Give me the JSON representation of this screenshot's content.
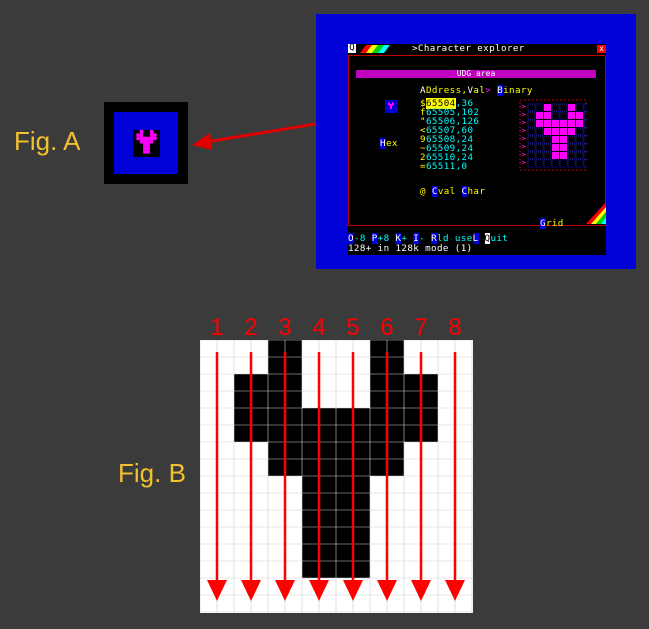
{
  "figures": {
    "a_label": "Fig. A",
    "b_label": "Fig. B"
  },
  "screen": {
    "title": ">Character explorer",
    "q_glyph": "Q",
    "close_glyph": "x",
    "udg_area": "UDG area",
    "header": {
      "address_a": "A",
      "address_rest": "Ddress,",
      "val_v": "V",
      "val_rest": "al",
      "sep": ">",
      "binary_b": "B",
      "binary_rest": "inary"
    },
    "hex_h": "H",
    "hex_rest": "ex",
    "rows": [
      {
        "prefix": "$",
        "address": "65504",
        "value": ",36"
      },
      {
        "prefix": "f",
        "address": "65505",
        "value": ",102"
      },
      {
        "prefix": "\"",
        "address": "65506",
        "value": ",126"
      },
      {
        "prefix": "<",
        "address": "65507",
        "value": ",60"
      },
      {
        "prefix": "9",
        "address": "65508",
        "value": ",24"
      },
      {
        "prefix": "~",
        "address": "65509",
        "value": ",24"
      },
      {
        "prefix": "2",
        "address": "65510",
        "value": ",24"
      },
      {
        "prefix": "=",
        "address": "65511",
        "value": ",0"
      }
    ],
    "options": {
      "at": "@",
      "cval_c": "C",
      "cval_rest": "val",
      "char_c": "C",
      "char_rest": "har"
    },
    "grid_g": "G",
    "grid_rest": "rid",
    "bottom_line1": {
      "o": "O",
      "o_rest": "-8 ",
      "p": "P",
      "p_rest": "+8 ",
      "k": "K",
      "k_rest": "+ ",
      "i": "I",
      "i_rest": "- ",
      "r": "R",
      "r_rest": "ld use",
      "l": "L",
      "q": "Q",
      "q_rest": "uit"
    },
    "bottom_line2": "128+ in 128k mode (1)"
  },
  "bitmap": {
    "rows": [
      [
        0,
        0,
        1,
        0,
        0,
        1,
        0,
        0
      ],
      [
        0,
        1,
        1,
        0,
        0,
        1,
        1,
        0
      ],
      [
        0,
        1,
        1,
        1,
        1,
        1,
        1,
        0
      ],
      [
        0,
        0,
        1,
        1,
        1,
        1,
        0,
        0
      ],
      [
        0,
        0,
        0,
        1,
        1,
        0,
        0,
        0
      ],
      [
        0,
        0,
        0,
        1,
        1,
        0,
        0,
        0
      ],
      [
        0,
        0,
        0,
        1,
        1,
        0,
        0,
        0
      ],
      [
        0,
        0,
        0,
        0,
        0,
        0,
        0,
        0
      ]
    ],
    "column_numbers": [
      "1",
      "2",
      "3",
      "4",
      "5",
      "6",
      "7",
      "8"
    ],
    "ink_color": "#000000",
    "paper_color": "#ffffff",
    "preview_ink": "#ff00ff",
    "arrow_color": "#ff0000"
  }
}
